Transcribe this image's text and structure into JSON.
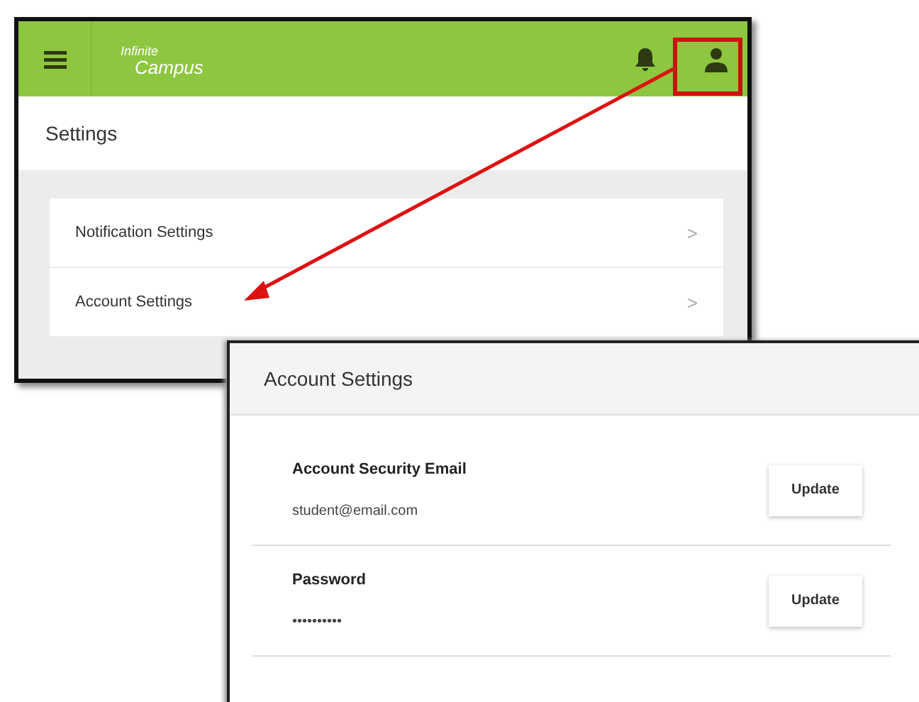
{
  "main_window": {
    "logo": [
      "Infinite",
      "Campus"
    ],
    "title": "Settings",
    "items": [
      {
        "label": "Notification Settings",
        "chevron": ">"
      },
      {
        "label": "Account Settings",
        "chevron": ">"
      }
    ]
  },
  "account_window": {
    "title": "Account Settings",
    "rows": [
      {
        "label": "Account Security Email",
        "value": "student@email.com",
        "button": "Update"
      },
      {
        "label": "Password",
        "value": "••••••••••",
        "button": "Update"
      }
    ]
  }
}
